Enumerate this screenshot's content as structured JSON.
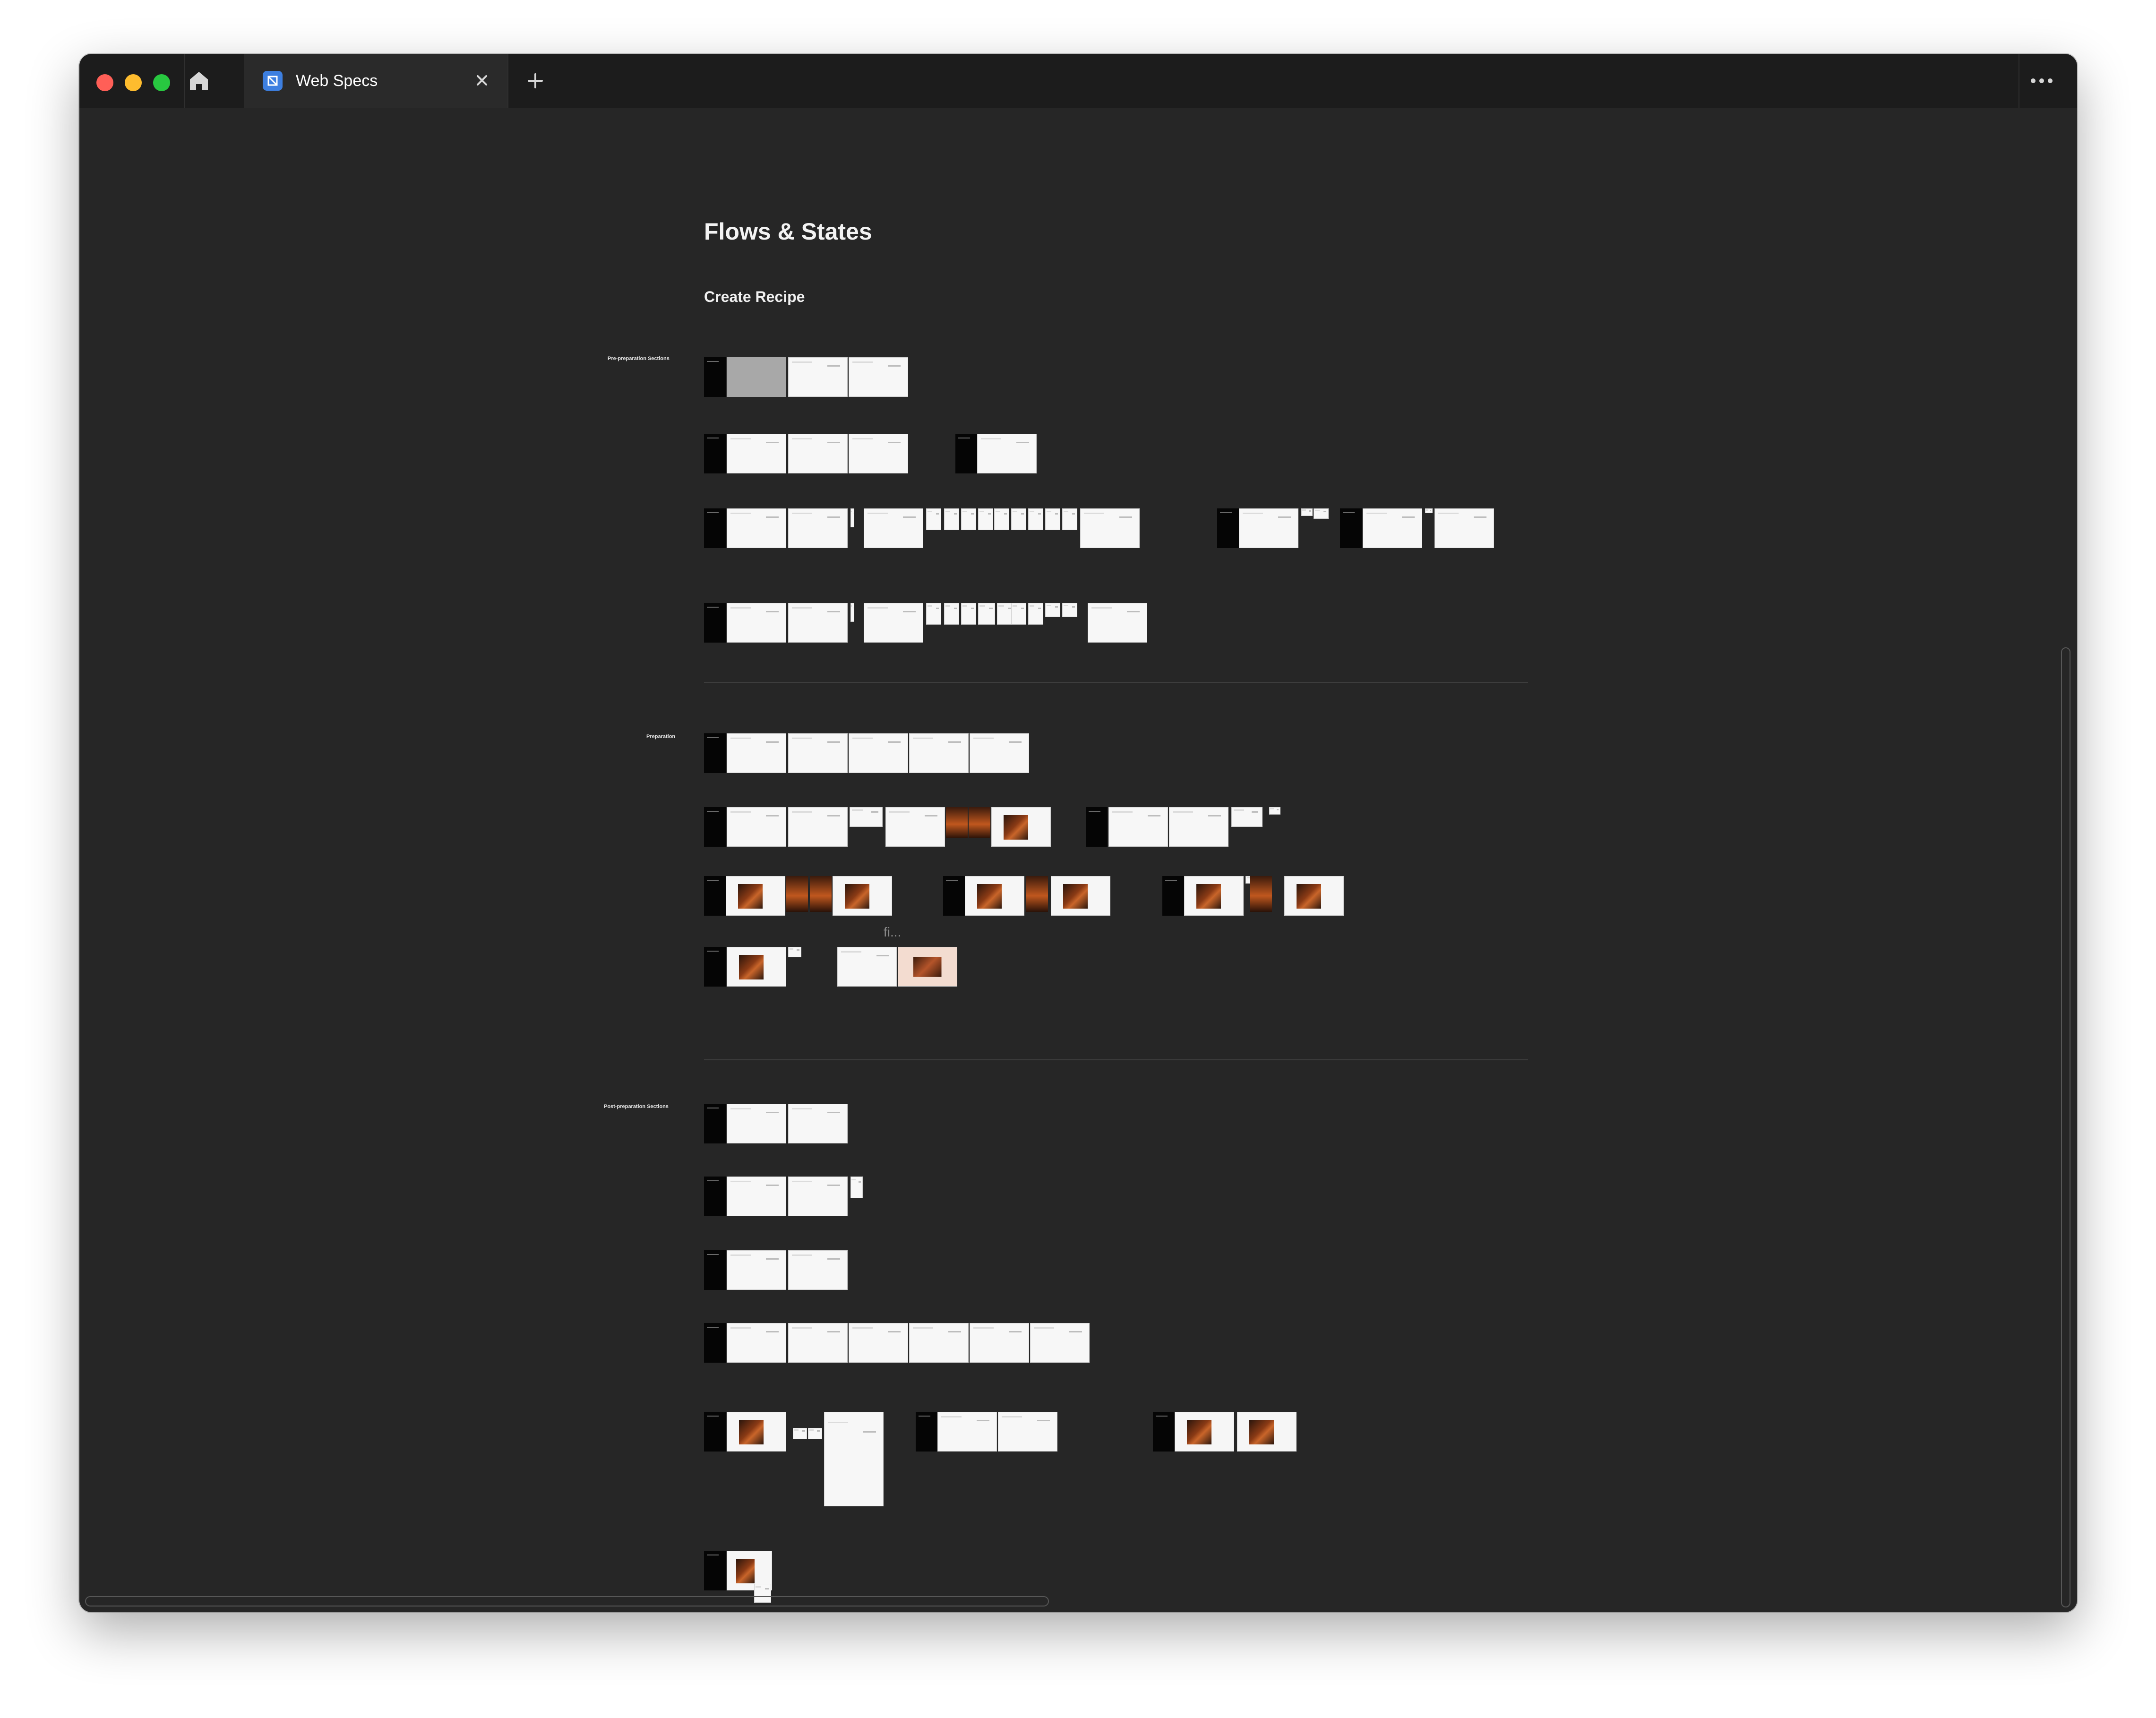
{
  "window": {
    "controls": {
      "close_color": "#ff5f57",
      "minimize_color": "#febc2e",
      "zoom_color": "#28c840"
    },
    "home_icon": "home-icon",
    "tab": {
      "title": "Web Specs",
      "icon": "figma-file-icon",
      "close_icon": "close-icon"
    },
    "new_tab_icon": "plus-icon",
    "menu_icon": "more-horizontal-icon"
  },
  "canvas": {
    "page_title": "Flows & States",
    "subtitle": "Create Recipe",
    "sections": [
      {
        "label": "Pre-preparation Sections"
      },
      {
        "label": "Preparation"
      },
      {
        "label": "Post-preparation Sections"
      }
    ],
    "flow_label": "fi..."
  }
}
